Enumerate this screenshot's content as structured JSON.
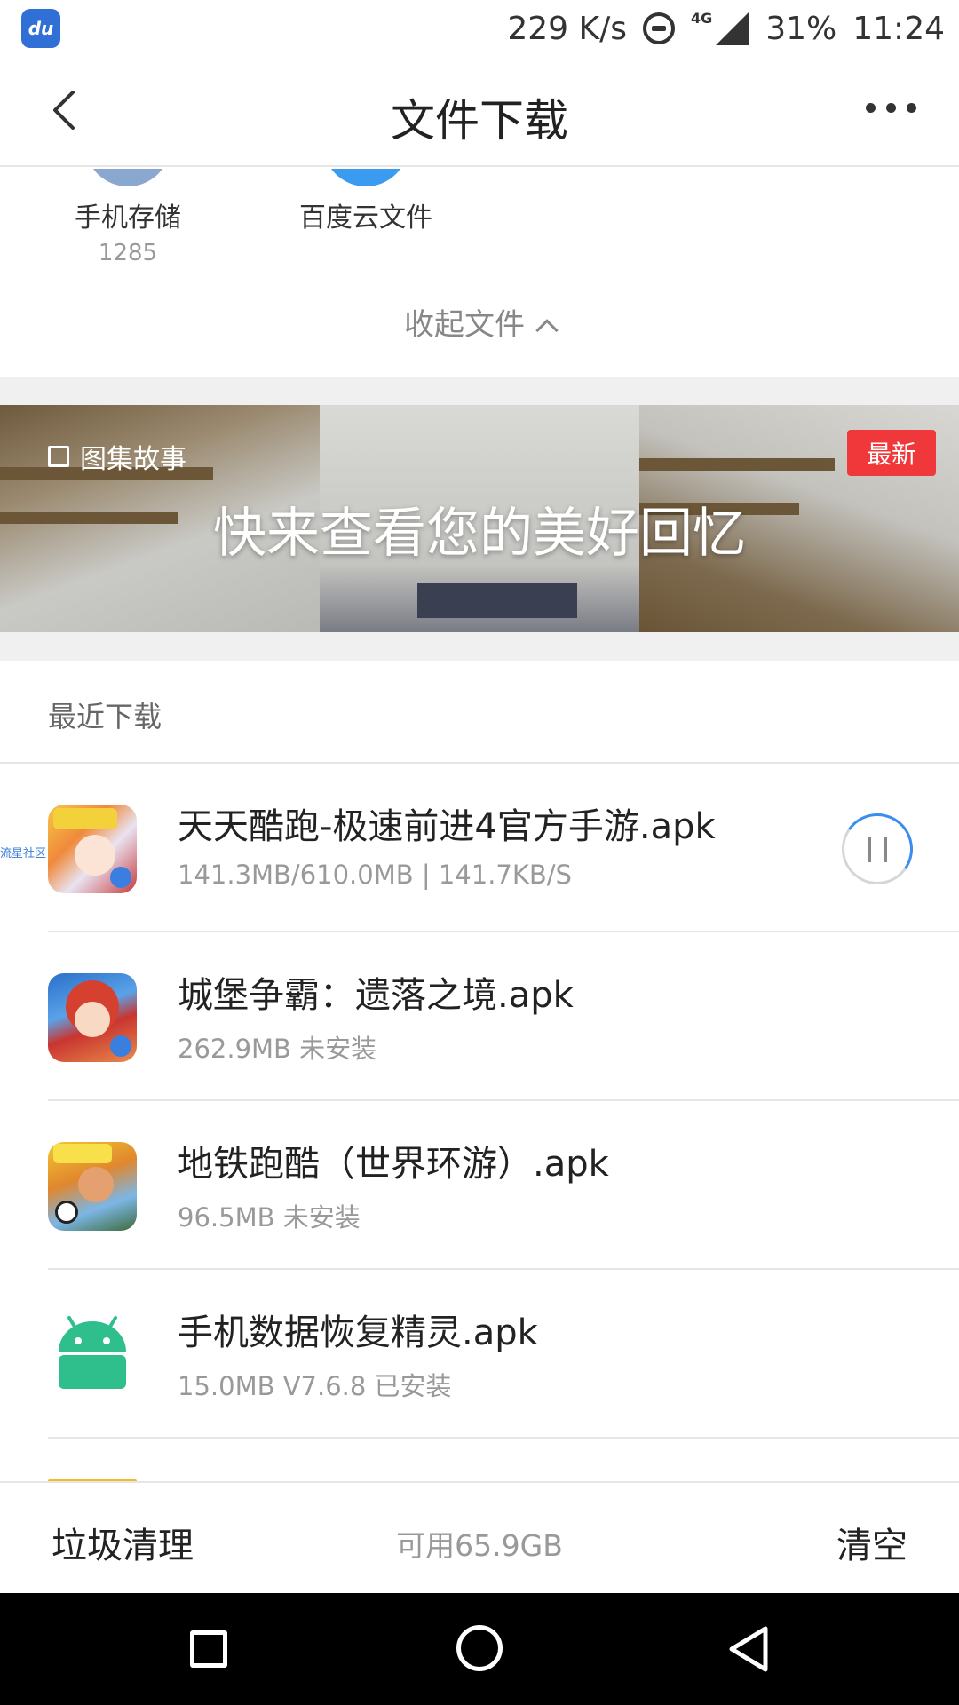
{
  "status_bar": {
    "app_logo_text": "du",
    "net_speed": "229 K/s",
    "network_type": "4G",
    "battery": "31%",
    "time": "11:24"
  },
  "header": {
    "title": "文件下载"
  },
  "storage": {
    "items": [
      {
        "label": "手机存储",
        "count": "1285",
        "color": "#8aa7cf"
      },
      {
        "label": "百度云文件",
        "count": "",
        "color": "#3b9bf0"
      }
    ],
    "collapse_label": "收起文件"
  },
  "banner": {
    "tag": "图集故事",
    "text": "快来查看您的美好回忆",
    "badge": "最新"
  },
  "recent": {
    "title": "最近下载",
    "items": [
      {
        "name": "天天酷跑-极速前进4官方手游.apk",
        "meta": "141.3MB/610.0MB | 141.7KB/S",
        "icon": "tiantian-kupao-icon",
        "downloading": true,
        "progress": 0.23
      },
      {
        "name": "城堡争霸：遗落之境.apk",
        "meta": "262.9MB 未安装",
        "icon": "chengbao-zhengba-icon",
        "downloading": false
      },
      {
        "name": "地铁跑酷（世界环游）.apk",
        "meta": "96.5MB 未安装",
        "icon": "subway-surfers-icon",
        "downloading": false
      },
      {
        "name": "手机数据恢复精灵.apk",
        "meta": "15.0MB V7.6.8 已安装",
        "icon": "android-icon",
        "downloading": false
      }
    ],
    "watermark": "流星社区"
  },
  "bottom_bar": {
    "clean_label": "垃圾清理",
    "space_label": "可用65.9GB",
    "clear_label": "清空"
  },
  "colors": {
    "accent_blue": "#3a8ef0",
    "badge_red": "#f0373a",
    "android_green": "#2fbf8c"
  }
}
